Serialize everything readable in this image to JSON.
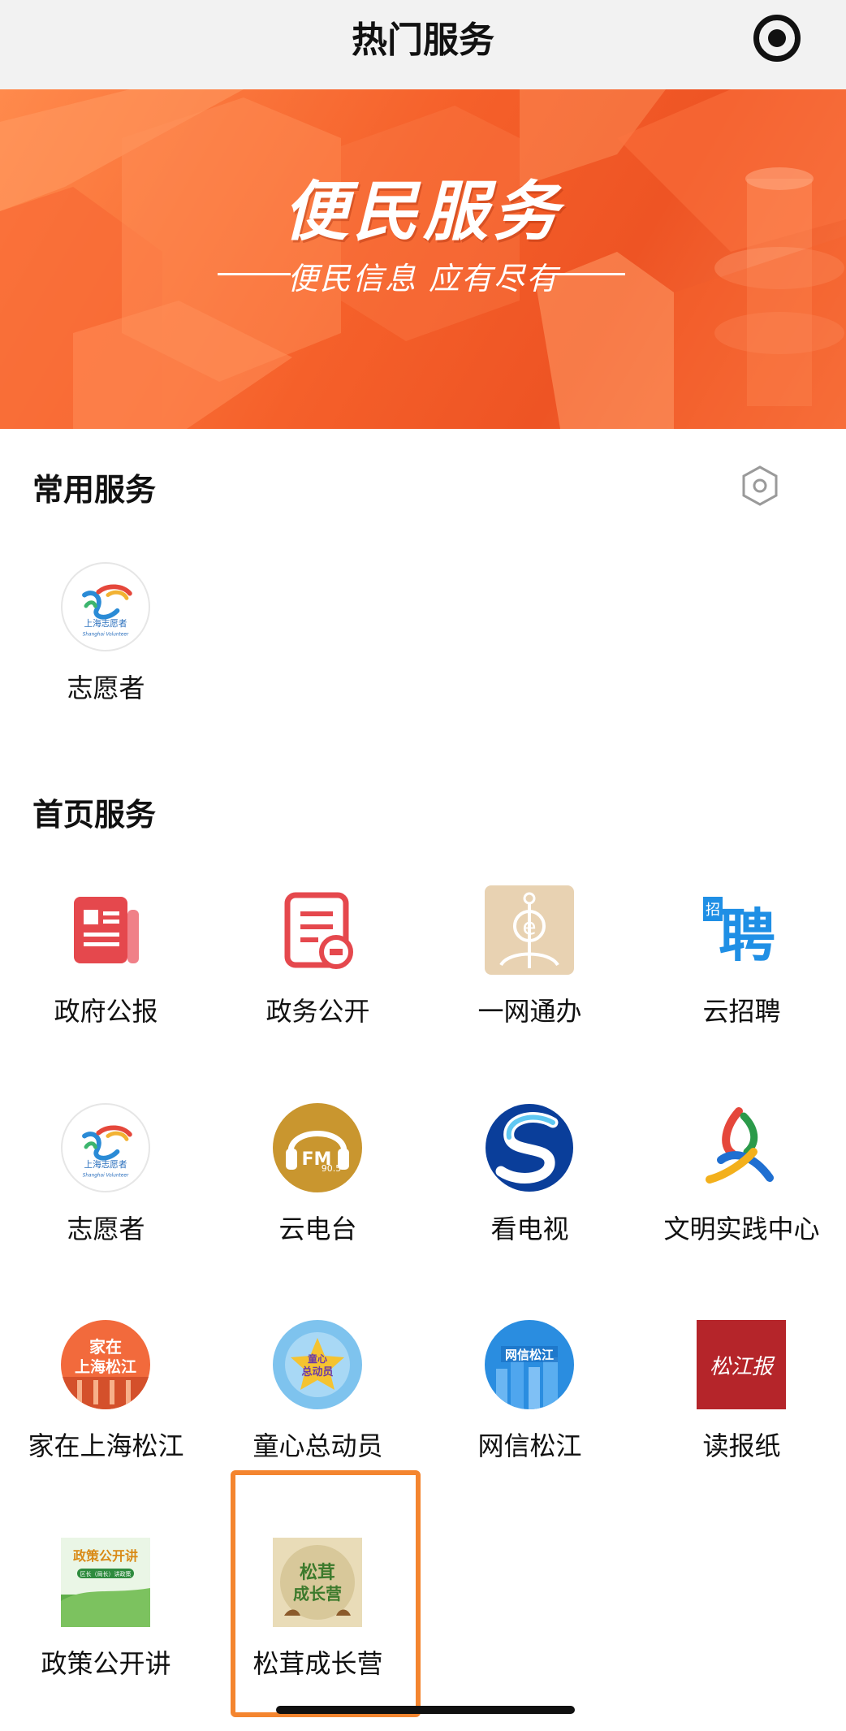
{
  "nav": {
    "title": "热门服务",
    "right_icon": "target-record-icon"
  },
  "banner": {
    "title": "便民服务",
    "subtitle": "便民信息 应有尽有",
    "colors": {
      "base": "#f5602a",
      "light": "#ff8a4c"
    }
  },
  "common_services": {
    "title": "常用服务",
    "settings_icon": "hexagon-settings-icon",
    "items": [
      {
        "label": "志愿者",
        "icon": "shanghai-volunteer-logo-icon",
        "logo_text": "上海志愿者",
        "logo_sub": "Shanghai Volunteer"
      }
    ]
  },
  "home_services": {
    "title": "首页服务",
    "items": [
      {
        "label": "政府公报",
        "icon": "gazette-document-icon"
      },
      {
        "label": "政务公开",
        "icon": "public-affairs-document-icon"
      },
      {
        "label": "一网通办",
        "icon": "one-network-service-icon"
      },
      {
        "label": "云招聘",
        "icon": "recruitment-icon",
        "logo_text_small": "招",
        "logo_text": "聘"
      },
      {
        "label": "志愿者",
        "icon": "shanghai-volunteer-logo-icon",
        "logo_text": "上海志愿者",
        "logo_sub": "Shanghai Volunteer"
      },
      {
        "label": "云电台",
        "icon": "radio-fm-icon",
        "logo_text": "FM",
        "logo_num": "90.5"
      },
      {
        "label": "看电视",
        "icon": "tv-s-logo-icon"
      },
      {
        "label": "文明实践中心",
        "icon": "civilization-practice-logo-icon"
      },
      {
        "label": "家在上海松江",
        "icon": "home-in-songjiang-logo-icon",
        "logo_text": "家在上海松江"
      },
      {
        "label": "童心总动员",
        "icon": "children-mobilization-logo-icon",
        "logo_text": "童心总动员"
      },
      {
        "label": "网信松江",
        "icon": "cyberspace-songjiang-logo-icon",
        "logo_text": "网信松江"
      },
      {
        "label": "读报纸",
        "icon": "newspaper-logo-icon",
        "logo_text": "松江报"
      },
      {
        "label": "政策公开讲",
        "icon": "policy-talk-logo-icon",
        "logo_text": "政策公开讲",
        "logo_sub": "区长（局长）讲政策"
      },
      {
        "label": "松茸成长营",
        "icon": "matsutake-growth-camp-logo-icon",
        "logo_text": "松茸成长营",
        "highlighted": true
      }
    ]
  },
  "colors": {
    "highlight_border": "#f4852f",
    "accent_red": "#e2473f"
  }
}
